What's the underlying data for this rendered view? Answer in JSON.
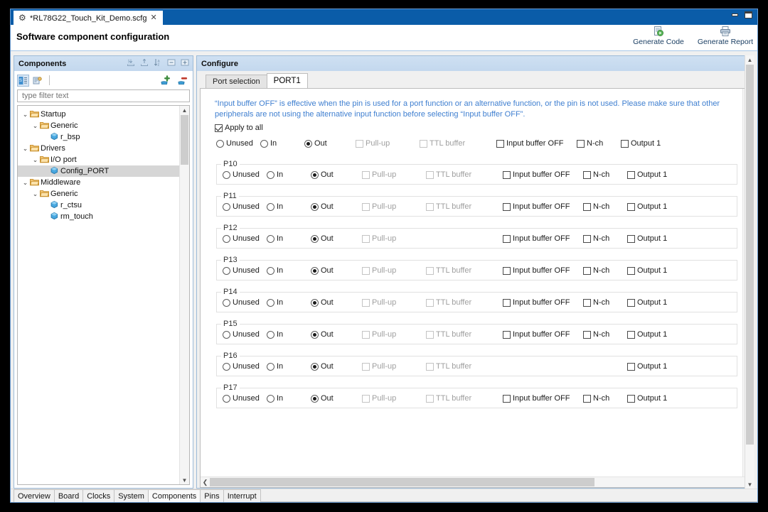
{
  "window": {
    "tab_title": "*RL78G22_Touch_Kit_Demo.scfg",
    "tab_close": "✕",
    "icon": "gear-icon",
    "minimize": "minimize-icon",
    "maximize": "maximize-icon"
  },
  "header": {
    "title": "Software component configuration",
    "actions": [
      {
        "label": "Generate Code",
        "icon": "generate-code-icon"
      },
      {
        "label": "Generate Report",
        "icon": "generate-report-icon"
      }
    ]
  },
  "components_panel": {
    "title": "Components",
    "header_tools": [
      "import-icon",
      "export-icon",
      "sort-icon",
      "collapse-all-icon",
      "expand-all-icon"
    ],
    "toolbar": {
      "left": [
        "component-view-icon",
        "hardware-view-icon"
      ],
      "right": [
        "add-component-icon",
        "remove-component-icon"
      ]
    },
    "filter": {
      "value": "",
      "placeholder": "type filter text"
    },
    "tree": [
      {
        "indent": 0,
        "twisty": "⌄",
        "icon": "folder-icon",
        "label": "Startup",
        "selected": false
      },
      {
        "indent": 1,
        "twisty": "⌄",
        "icon": "folder-icon",
        "label": "Generic",
        "selected": false
      },
      {
        "indent": 2,
        "twisty": "",
        "icon": "component-icon",
        "label": "r_bsp",
        "selected": false
      },
      {
        "indent": 0,
        "twisty": "⌄",
        "icon": "folder-icon",
        "label": "Drivers",
        "selected": false
      },
      {
        "indent": 1,
        "twisty": "⌄",
        "icon": "folder-icon",
        "label": "I/O port",
        "selected": false
      },
      {
        "indent": 2,
        "twisty": "",
        "icon": "component-icon",
        "label": "Config_PORT",
        "selected": true
      },
      {
        "indent": 0,
        "twisty": "⌄",
        "icon": "folder-icon",
        "label": "Middleware",
        "selected": false
      },
      {
        "indent": 1,
        "twisty": "⌄",
        "icon": "folder-icon",
        "label": "Generic",
        "selected": false
      },
      {
        "indent": 2,
        "twisty": "",
        "icon": "component-icon",
        "label": "r_ctsu",
        "selected": false
      },
      {
        "indent": 2,
        "twisty": "",
        "icon": "component-icon",
        "label": "rm_touch",
        "selected": false
      }
    ]
  },
  "configure_panel": {
    "title": "Configure",
    "tabs": [
      {
        "label": "Port selection",
        "active": false
      },
      {
        "label": "PORT1",
        "active": true
      }
    ],
    "note": "“Input buffer OFF” is effective when the pin is used for a port function or an alternative function, or the pin is not used. Please make sure that other peripherals are not using the alternative input function before selecting “Input buffer OFF”.",
    "apply_to_all": {
      "label": "Apply to all",
      "checked": true
    },
    "option_labels": {
      "unused": "Unused",
      "in": "In",
      "out": "Out",
      "pullup": "Pull-up",
      "ttl": "TTL buffer",
      "ibuf": "Input buffer OFF",
      "nch": "N-ch",
      "out1": "Output 1"
    },
    "apply_row": {
      "mode": "out",
      "pullup": {
        "present": true,
        "checked": false,
        "enabled": false
      },
      "ttl": {
        "present": true,
        "checked": false,
        "enabled": false
      },
      "ibuf": {
        "present": true,
        "checked": false,
        "enabled": true
      },
      "nch": {
        "present": true,
        "checked": false,
        "enabled": true
      },
      "out1": {
        "present": true,
        "checked": false,
        "enabled": true
      }
    },
    "pins": [
      {
        "name": "P10",
        "mode": "out",
        "pullup": {
          "present": true,
          "checked": false,
          "enabled": false
        },
        "ttl": {
          "present": true,
          "checked": false,
          "enabled": false
        },
        "ibuf": {
          "present": true,
          "checked": false,
          "enabled": true
        },
        "nch": {
          "present": true,
          "checked": false,
          "enabled": true
        },
        "out1": {
          "present": true,
          "checked": false,
          "enabled": true
        }
      },
      {
        "name": "P11",
        "mode": "out",
        "pullup": {
          "present": true,
          "checked": false,
          "enabled": false
        },
        "ttl": {
          "present": true,
          "checked": false,
          "enabled": false
        },
        "ibuf": {
          "present": true,
          "checked": false,
          "enabled": true
        },
        "nch": {
          "present": true,
          "checked": false,
          "enabled": true
        },
        "out1": {
          "present": true,
          "checked": false,
          "enabled": true
        }
      },
      {
        "name": "P12",
        "mode": "out",
        "pullup": {
          "present": true,
          "checked": false,
          "enabled": false
        },
        "ttl": {
          "present": false,
          "checked": false,
          "enabled": false
        },
        "ibuf": {
          "present": true,
          "checked": false,
          "enabled": true
        },
        "nch": {
          "present": true,
          "checked": false,
          "enabled": true
        },
        "out1": {
          "present": true,
          "checked": false,
          "enabled": true
        }
      },
      {
        "name": "P13",
        "mode": "out",
        "pullup": {
          "present": true,
          "checked": false,
          "enabled": false
        },
        "ttl": {
          "present": true,
          "checked": false,
          "enabled": false
        },
        "ibuf": {
          "present": true,
          "checked": false,
          "enabled": true
        },
        "nch": {
          "present": true,
          "checked": false,
          "enabled": true
        },
        "out1": {
          "present": true,
          "checked": false,
          "enabled": true
        }
      },
      {
        "name": "P14",
        "mode": "out",
        "pullup": {
          "present": true,
          "checked": false,
          "enabled": false
        },
        "ttl": {
          "present": true,
          "checked": false,
          "enabled": false
        },
        "ibuf": {
          "present": true,
          "checked": false,
          "enabled": true
        },
        "nch": {
          "present": true,
          "checked": false,
          "enabled": true
        },
        "out1": {
          "present": true,
          "checked": false,
          "enabled": true
        }
      },
      {
        "name": "P15",
        "mode": "out",
        "pullup": {
          "present": true,
          "checked": false,
          "enabled": false
        },
        "ttl": {
          "present": true,
          "checked": false,
          "enabled": false
        },
        "ibuf": {
          "present": true,
          "checked": false,
          "enabled": true
        },
        "nch": {
          "present": true,
          "checked": false,
          "enabled": true
        },
        "out1": {
          "present": true,
          "checked": false,
          "enabled": true
        }
      },
      {
        "name": "P16",
        "mode": "out",
        "pullup": {
          "present": true,
          "checked": false,
          "enabled": false
        },
        "ttl": {
          "present": true,
          "checked": false,
          "enabled": false
        },
        "ibuf": {
          "present": false,
          "checked": false,
          "enabled": true
        },
        "nch": {
          "present": false,
          "checked": false,
          "enabled": true
        },
        "out1": {
          "present": true,
          "checked": false,
          "enabled": true
        }
      },
      {
        "name": "P17",
        "mode": "out",
        "pullup": {
          "present": true,
          "checked": false,
          "enabled": false
        },
        "ttl": {
          "present": true,
          "checked": false,
          "enabled": false
        },
        "ibuf": {
          "present": true,
          "checked": false,
          "enabled": true
        },
        "nch": {
          "present": true,
          "checked": false,
          "enabled": true
        },
        "out1": {
          "present": true,
          "checked": false,
          "enabled": true
        }
      }
    ]
  },
  "footer_tabs": [
    {
      "label": "Overview",
      "active": false
    },
    {
      "label": "Board",
      "active": false
    },
    {
      "label": "Clocks",
      "active": false
    },
    {
      "label": "System",
      "active": false
    },
    {
      "label": "Components",
      "active": true
    },
    {
      "label": "Pins",
      "active": false
    },
    {
      "label": "Interrupt",
      "active": false
    }
  ],
  "colors": {
    "titlebar": "#0a5ca8",
    "note_text": "#3f7fd0",
    "panel_header": "#c7dcf0",
    "selection": "#d6d6d6"
  }
}
